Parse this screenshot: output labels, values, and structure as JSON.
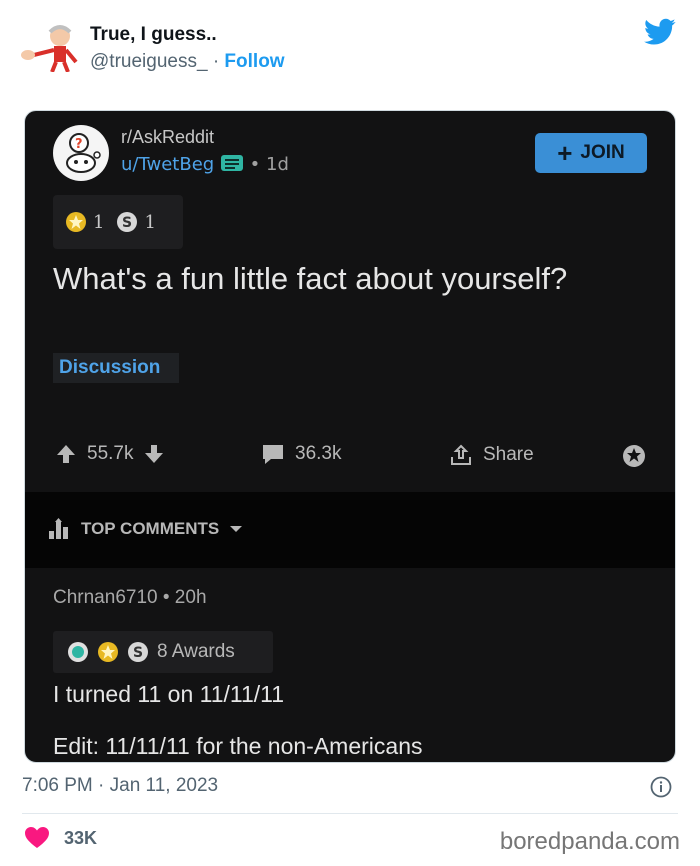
{
  "tweet": {
    "author_name": "True, I guess..",
    "handle": "@trueiguess_",
    "separator": "·",
    "follow_label": "Follow",
    "timestamp": "7:06 PM · Jan 11, 2023",
    "likes": "33K"
  },
  "reddit": {
    "subreddit": "r/AskReddit",
    "username": "u/TwetBeg",
    "time": "• 1d",
    "join_label": "JOIN",
    "post_awards": [
      "1",
      "1"
    ],
    "title": "What's a fun little fact about yourself?",
    "flair": "Discussion",
    "upvotes": "55.7k",
    "comments": "36.3k",
    "share_label": "Share",
    "sort_label": "TOP COMMENTS",
    "comment": {
      "user": "Chrnan6710",
      "time": "• 20h",
      "awards": "8 Awards",
      "line1": "I turned 11 on 11/11/11",
      "line2": "Edit: 11/11/11 for the non-Americans"
    }
  },
  "watermark": "boredpanda.com",
  "colors": {
    "twitter_blue": "#1d9bf0",
    "reddit_bg": "#121213",
    "reddit_link": "#4fa3e8",
    "like_heart": "#f91880"
  },
  "icons": [
    "avatar-cartoon",
    "twitter-bird-icon",
    "upvote-icon",
    "downvote-icon",
    "comment-icon",
    "share-icon",
    "award-icon",
    "bar-chart-icon",
    "chevron-down-icon",
    "info-icon",
    "heart-icon"
  ]
}
